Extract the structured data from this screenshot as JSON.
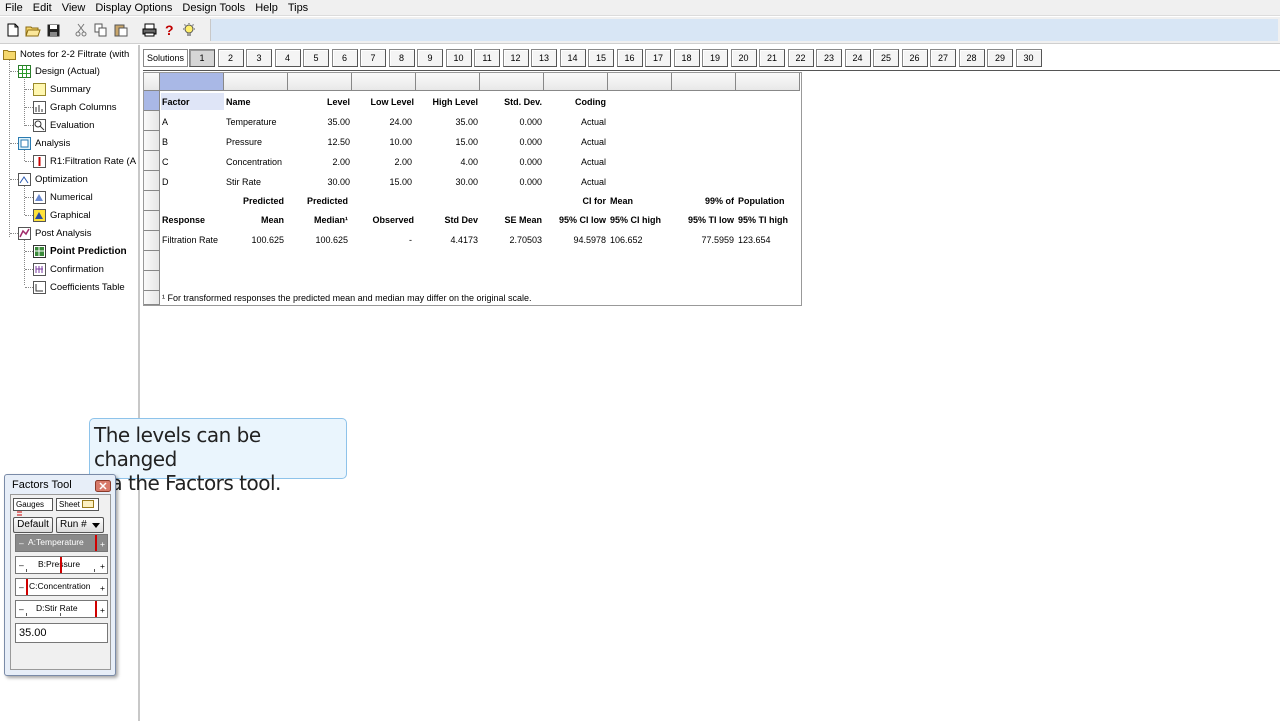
{
  "menu": [
    "File",
    "Edit",
    "View",
    "Display Options",
    "Design Tools",
    "Help",
    "Tips"
  ],
  "tree": {
    "root": "Notes for 2-2 Filtrate (with",
    "design": "Design (Actual)",
    "summary": "Summary",
    "graph_columns": "Graph Columns",
    "evaluation": "Evaluation",
    "analysis": "Analysis",
    "r1": "R1:Filtration Rate (A",
    "optimization": "Optimization",
    "numerical": "Numerical",
    "graphical": "Graphical",
    "post_analysis": "Post Analysis",
    "point_prediction": "Point Prediction",
    "confirmation": "Confirmation",
    "coefficients_table": "Coefficients Table"
  },
  "solutions": {
    "label": "Solutions",
    "tabs": [
      "1",
      "2",
      "3",
      "4",
      "5",
      "6",
      "7",
      "8",
      "9",
      "10",
      "11",
      "12",
      "13",
      "14",
      "15",
      "16",
      "17",
      "18",
      "19",
      "20",
      "21",
      "22",
      "23",
      "24",
      "25",
      "26",
      "27",
      "28",
      "29",
      "30"
    ],
    "active": "1"
  },
  "factors_table": {
    "headers": [
      "Factor",
      "Name",
      "Level",
      "Low Level",
      "High Level",
      "Std. Dev.",
      "Coding"
    ],
    "rows": [
      [
        "A",
        "Temperature",
        "35.00",
        "24.00",
        "35.00",
        "0.000",
        "Actual"
      ],
      [
        "B",
        "Pressure",
        "12.50",
        "10.00",
        "15.00",
        "0.000",
        "Actual"
      ],
      [
        "C",
        "Concentration",
        "2.00",
        "2.00",
        "4.00",
        "0.000",
        "Actual"
      ],
      [
        "D",
        "Stir Rate",
        "30.00",
        "15.00",
        "30.00",
        "0.000",
        "Actual"
      ]
    ]
  },
  "prediction_table": {
    "header1": {
      "mean": "Predicted",
      "median": "Predicted",
      "ci_low": "CI for",
      "ci_high": "Mean",
      "tl_low": "99% of",
      "tl_high": "Population"
    },
    "header2": [
      "Response",
      "Mean",
      "Median¹",
      "Observed",
      "Std Dev",
      "SE Mean",
      "95% CI low",
      "95% CI high",
      "95% TI low",
      "95% TI high"
    ],
    "row": [
      "Filtration Rate",
      "100.625",
      "100.625",
      "-",
      "4.4173",
      "2.70503",
      "94.5978",
      "106.652",
      "77.5959",
      "123.654"
    ]
  },
  "footnote": "¹ For transformed responses the predicted mean and median may differ on the original scale.",
  "callout": {
    "line1": "The levels can be changed",
    "line2": "via the Factors tool."
  },
  "factors_tool": {
    "title": "Factors Tool",
    "tab_gauges": "Gauges",
    "tab_sheet": "Sheet",
    "default_button": "Default",
    "run_select": "Run #",
    "gauges": [
      {
        "label": "A:Temperature",
        "active": true
      },
      {
        "label": "B:Pressure",
        "active": false
      },
      {
        "label": "C:Concentration",
        "active": false
      },
      {
        "label": "D:Stir Rate",
        "active": false
      }
    ],
    "minus": "–",
    "plus": "+",
    "value": "35.00"
  }
}
